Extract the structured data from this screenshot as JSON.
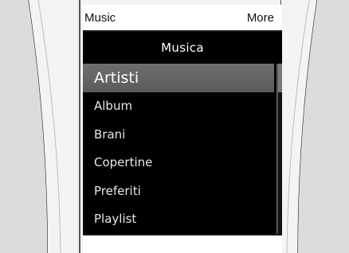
{
  "softkeys": {
    "left": "Music",
    "right": "More"
  },
  "screen_title": "Musica",
  "menu": {
    "items": [
      {
        "label": "Artisti",
        "selected": true
      },
      {
        "label": "Album",
        "selected": false
      },
      {
        "label": "Brani",
        "selected": false
      },
      {
        "label": "Copertine",
        "selected": false
      },
      {
        "label": "Preferiti",
        "selected": false
      },
      {
        "label": "Playlist",
        "selected": false
      }
    ]
  },
  "colors": {
    "screen_background": "#000000",
    "selected_item_background": "#646464",
    "softkey_bar_background": "#ffffff"
  }
}
